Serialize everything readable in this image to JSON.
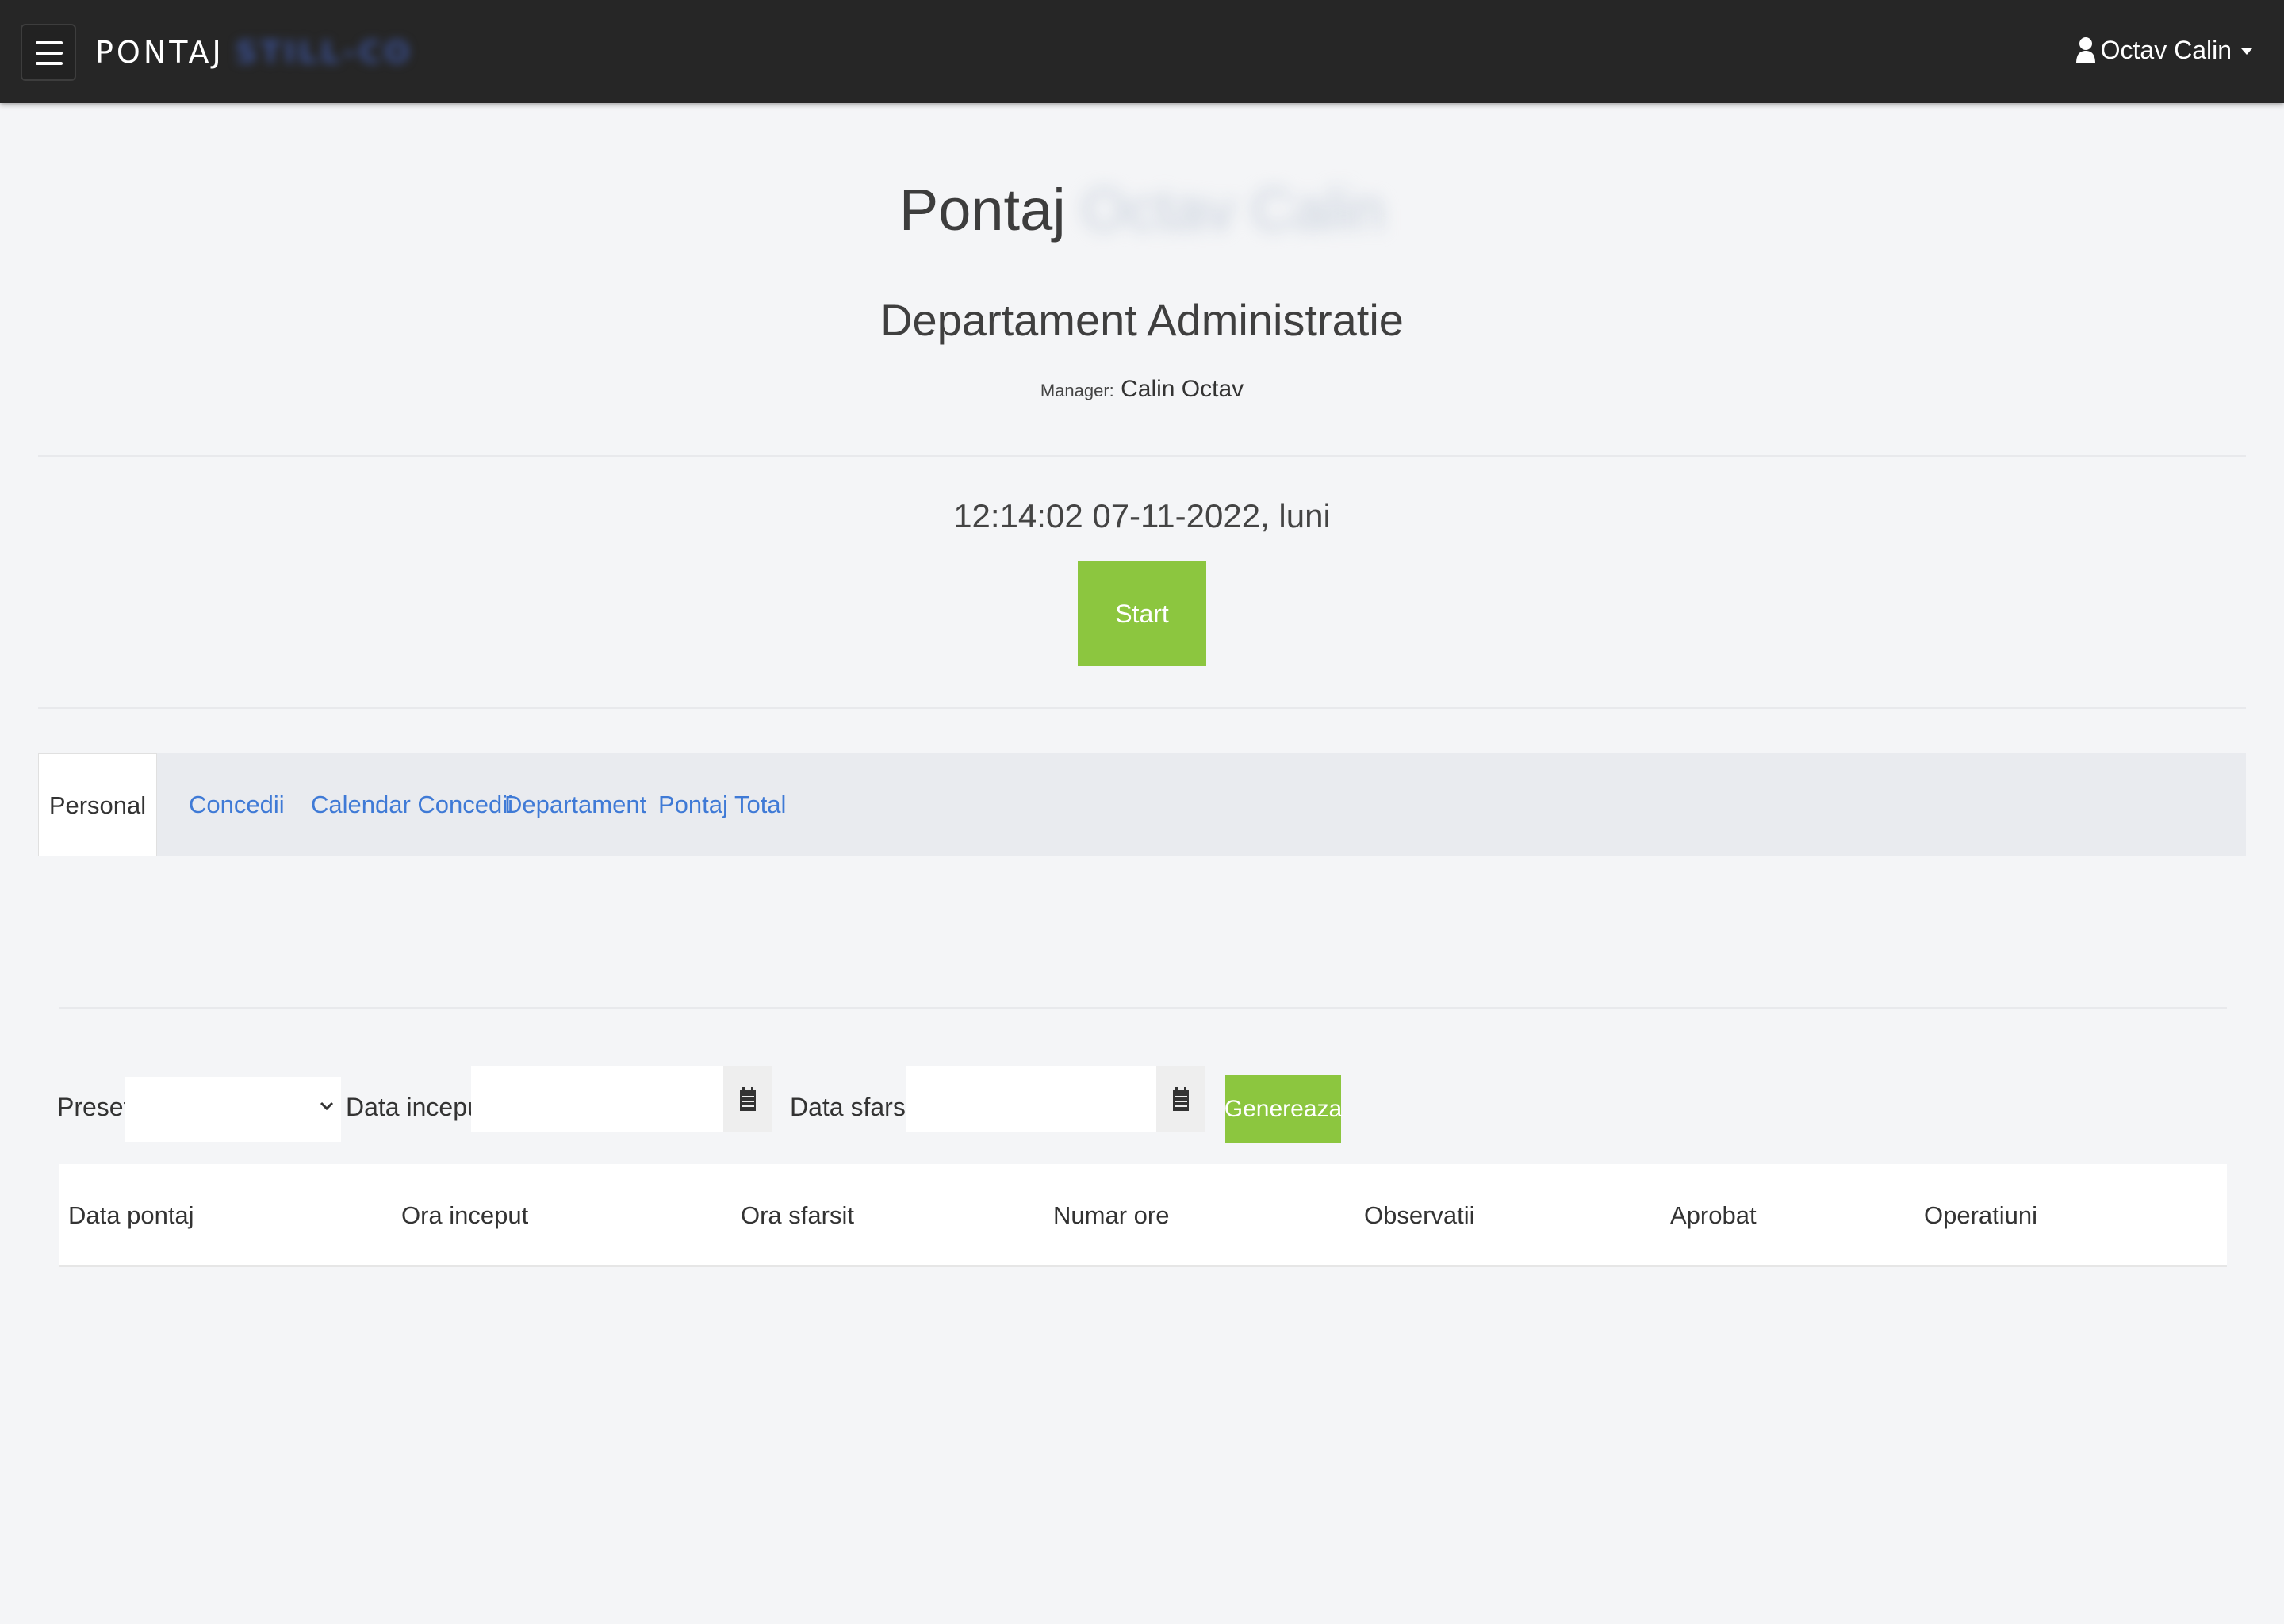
{
  "navbar": {
    "brand": "PONTAJ",
    "brand_blurred": "STILL-CO",
    "user_name": "Octav Calin"
  },
  "header": {
    "title": "Pontaj",
    "title_blurred": "Octav Calin",
    "department": "Departament Administratie",
    "manager_label": "Manager:",
    "manager_name": "Calin Octav"
  },
  "clock": {
    "datetime": "12:14:02 07-11-2022, luni",
    "start_label": "Start"
  },
  "tabs": [
    {
      "label": "Personal",
      "active": true
    },
    {
      "label": "Concedii",
      "active": false
    },
    {
      "label": "Calendar Concedii",
      "active": false
    },
    {
      "label": "Departament",
      "active": false
    },
    {
      "label": "Pontaj Total",
      "active": false
    }
  ],
  "filters": {
    "presets_label": "Presets",
    "presets_value": "",
    "start_label": "Data inceput:",
    "start_value": "",
    "end_label": "Data sfarsit:",
    "end_value": "",
    "generate_label": "Genereaza"
  },
  "table": {
    "columns": [
      "Data pontaj",
      "Ora inceput",
      "Ora sfarsit",
      "Numar ore",
      "Observatii",
      "Aprobat",
      "Operatiuni"
    ]
  },
  "colors": {
    "navbar": "#262626",
    "accent_green": "#8cc63f",
    "link_blue": "#3f7ad6",
    "background": "#f4f5f7"
  },
  "icons": {
    "menu": "hamburger-icon",
    "user": "user-icon",
    "calendar": "calendar-icon",
    "dropdown": "chevron-down-icon"
  }
}
